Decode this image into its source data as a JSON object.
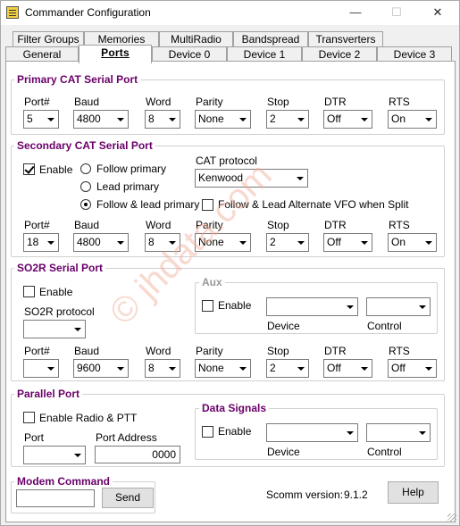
{
  "window": {
    "title": "Commander Configuration",
    "minimize": "—",
    "maximize": "☐",
    "close": "✕"
  },
  "tabs_row1": [
    "Filter Groups",
    "Memories",
    "MultiRadio",
    "Bandspread",
    "Transverters"
  ],
  "tabs_row2": [
    "General",
    "Ports",
    "Device 0",
    "Device 1",
    "Device 2",
    "Device 3"
  ],
  "selected_tab": "Ports",
  "primary": {
    "title": "Primary CAT Serial Port",
    "labels": [
      "Port#",
      "Baud",
      "Word",
      "Parity",
      "Stop",
      "DTR",
      "RTS"
    ],
    "values": [
      "5",
      "4800",
      "8",
      "None",
      "2",
      "Off",
      "On"
    ]
  },
  "secondary": {
    "title": "Secondary CAT Serial Port",
    "enable_label": "Enable",
    "enable_checked": true,
    "follow_primary": "Follow primary",
    "lead_primary": "Lead primary",
    "follow_lead_primary": "Follow & lead primary",
    "selected_mode": "Follow & lead primary",
    "cat_protocol_label": "CAT protocol",
    "cat_protocol_value": "Kenwood",
    "follow_alt_vfo_label": "Follow & Lead Alternate VFO when Split",
    "follow_alt_vfo_checked": false,
    "labels": [
      "Port#",
      "Baud",
      "Word",
      "Parity",
      "Stop",
      "DTR",
      "RTS"
    ],
    "values": [
      "18",
      "4800",
      "8",
      "None",
      "2",
      "Off",
      "On"
    ]
  },
  "so2r": {
    "title": "SO2R Serial Port",
    "enable_label": "Enable",
    "enable_checked": false,
    "protocol_label": "SO2R protocol",
    "protocol_value": "",
    "aux": {
      "title": "Aux",
      "enable_label": "Enable",
      "device_label": "Device",
      "control_label": "Control"
    },
    "labels": [
      "Port#",
      "Baud",
      "Word",
      "Parity",
      "Stop",
      "DTR",
      "RTS"
    ],
    "values": [
      "",
      "9600",
      "8",
      "None",
      "2",
      "Off",
      "Off"
    ]
  },
  "parallel": {
    "title": "Parallel Port",
    "enable_label": "Enable Radio & PTT",
    "enable_checked": false,
    "port_label": "Port",
    "port_value": "",
    "address_label": "Port Address",
    "address_value": "0000",
    "data_signals": {
      "title": "Data Signals",
      "enable_label": "Enable",
      "device_label": "Device",
      "control_label": "Control"
    }
  },
  "modem": {
    "title": "Modem Command",
    "input_value": "",
    "send_label": "Send"
  },
  "version": {
    "label": "Scomm version:",
    "value": "9.1.2"
  },
  "help_label": "Help",
  "watermark": "© jhdata.com"
}
